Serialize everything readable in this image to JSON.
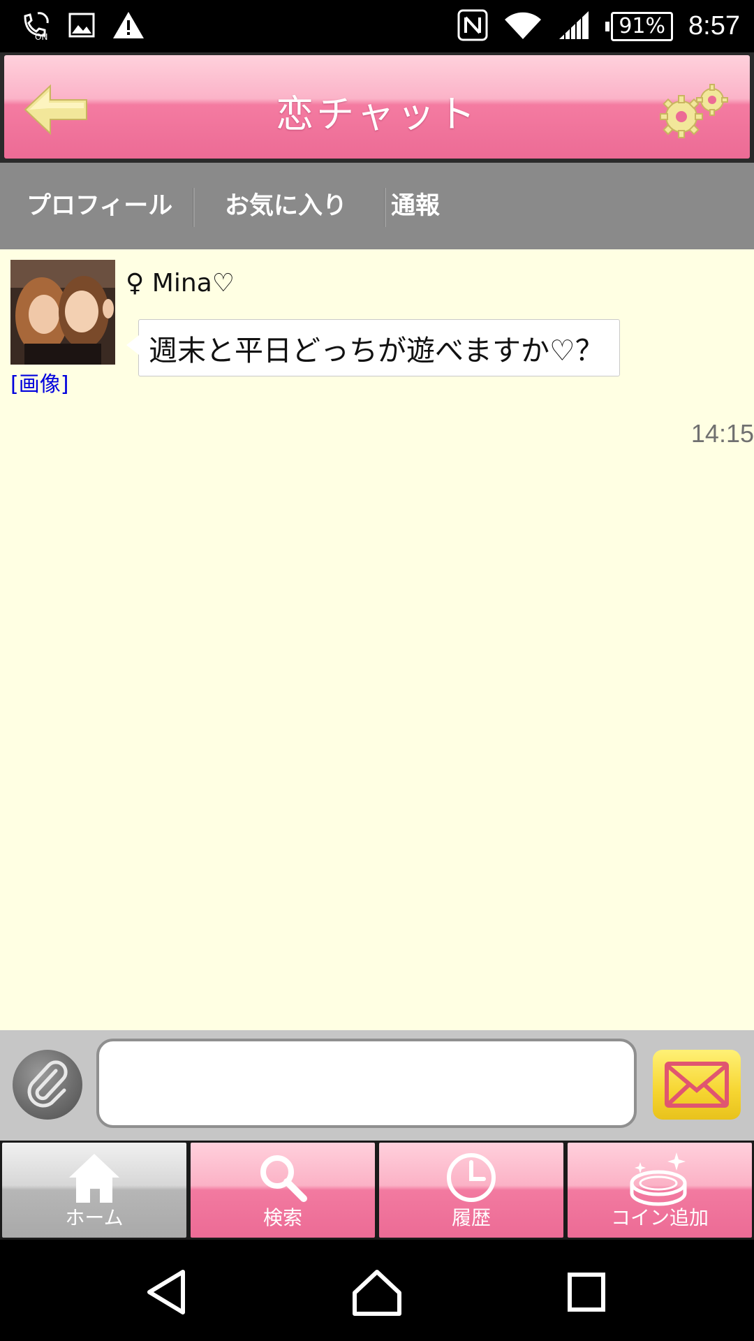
{
  "status_bar": {
    "time": "8:57",
    "battery_percent": "91%",
    "icons_left": [
      "call-on-icon",
      "image-icon",
      "warning-icon"
    ],
    "icons_right": [
      "nfc-icon",
      "wifi-icon",
      "signal-icon",
      "battery-icon"
    ]
  },
  "header": {
    "title": "恋チャット",
    "back_icon": "back-arrow-icon",
    "settings_icon": "gear-icon"
  },
  "subnav": {
    "items": [
      {
        "label": "プロフィール"
      },
      {
        "label": "お気に入り"
      },
      {
        "label": "通報"
      }
    ]
  },
  "chat": {
    "messages": [
      {
        "sender": "♀ Mina♡",
        "image_link": "[画像]",
        "text": "週末と平日どっちが遊べますか♡？",
        "time": "14:15"
      }
    ]
  },
  "input": {
    "value": "",
    "placeholder": "",
    "attach_icon": "paperclip-icon",
    "send_icon": "envelope-icon"
  },
  "tabs": [
    {
      "label": "ホーム",
      "icon": "home-icon",
      "active": true
    },
    {
      "label": "検索",
      "icon": "search-icon",
      "active": false
    },
    {
      "label": "履歴",
      "icon": "clock-icon",
      "active": false
    },
    {
      "label": "コイン追加",
      "icon": "coin-icon",
      "active": false
    }
  ],
  "colors": {
    "header_pink": "#ec6b95",
    "chat_background": "#ffffe3",
    "subnav_gray": "#8a8a8a",
    "link_blue": "#0000dd"
  }
}
